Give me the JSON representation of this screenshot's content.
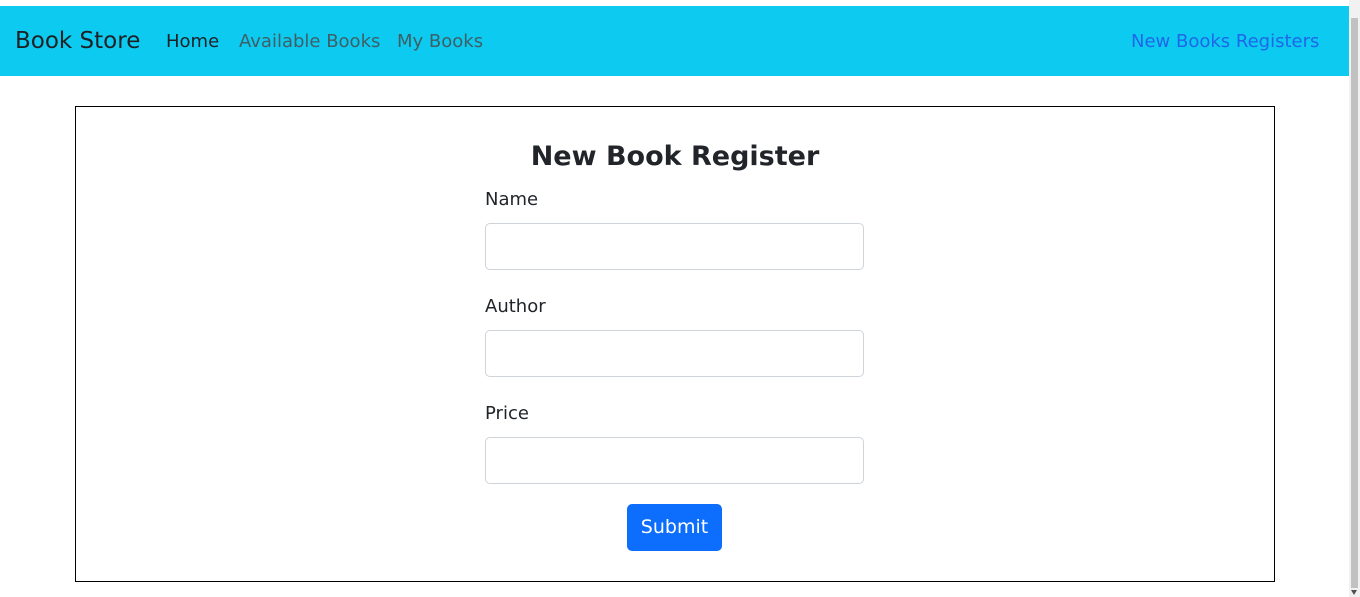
{
  "navbar": {
    "brand": "Book Store",
    "links": [
      {
        "label": "Home"
      },
      {
        "label": "Available Books"
      },
      {
        "label": "My Books"
      }
    ],
    "right_link": "New Books Registers",
    "background_color": "#0dcaf0"
  },
  "form": {
    "title": "New Book Register",
    "fields": [
      {
        "label": "Name",
        "value": "",
        "placeholder": ""
      },
      {
        "label": "Author",
        "value": "",
        "placeholder": ""
      },
      {
        "label": "Price",
        "value": "",
        "placeholder": ""
      }
    ],
    "submit_label": "Submit",
    "submit_color": "#0d6efd"
  }
}
